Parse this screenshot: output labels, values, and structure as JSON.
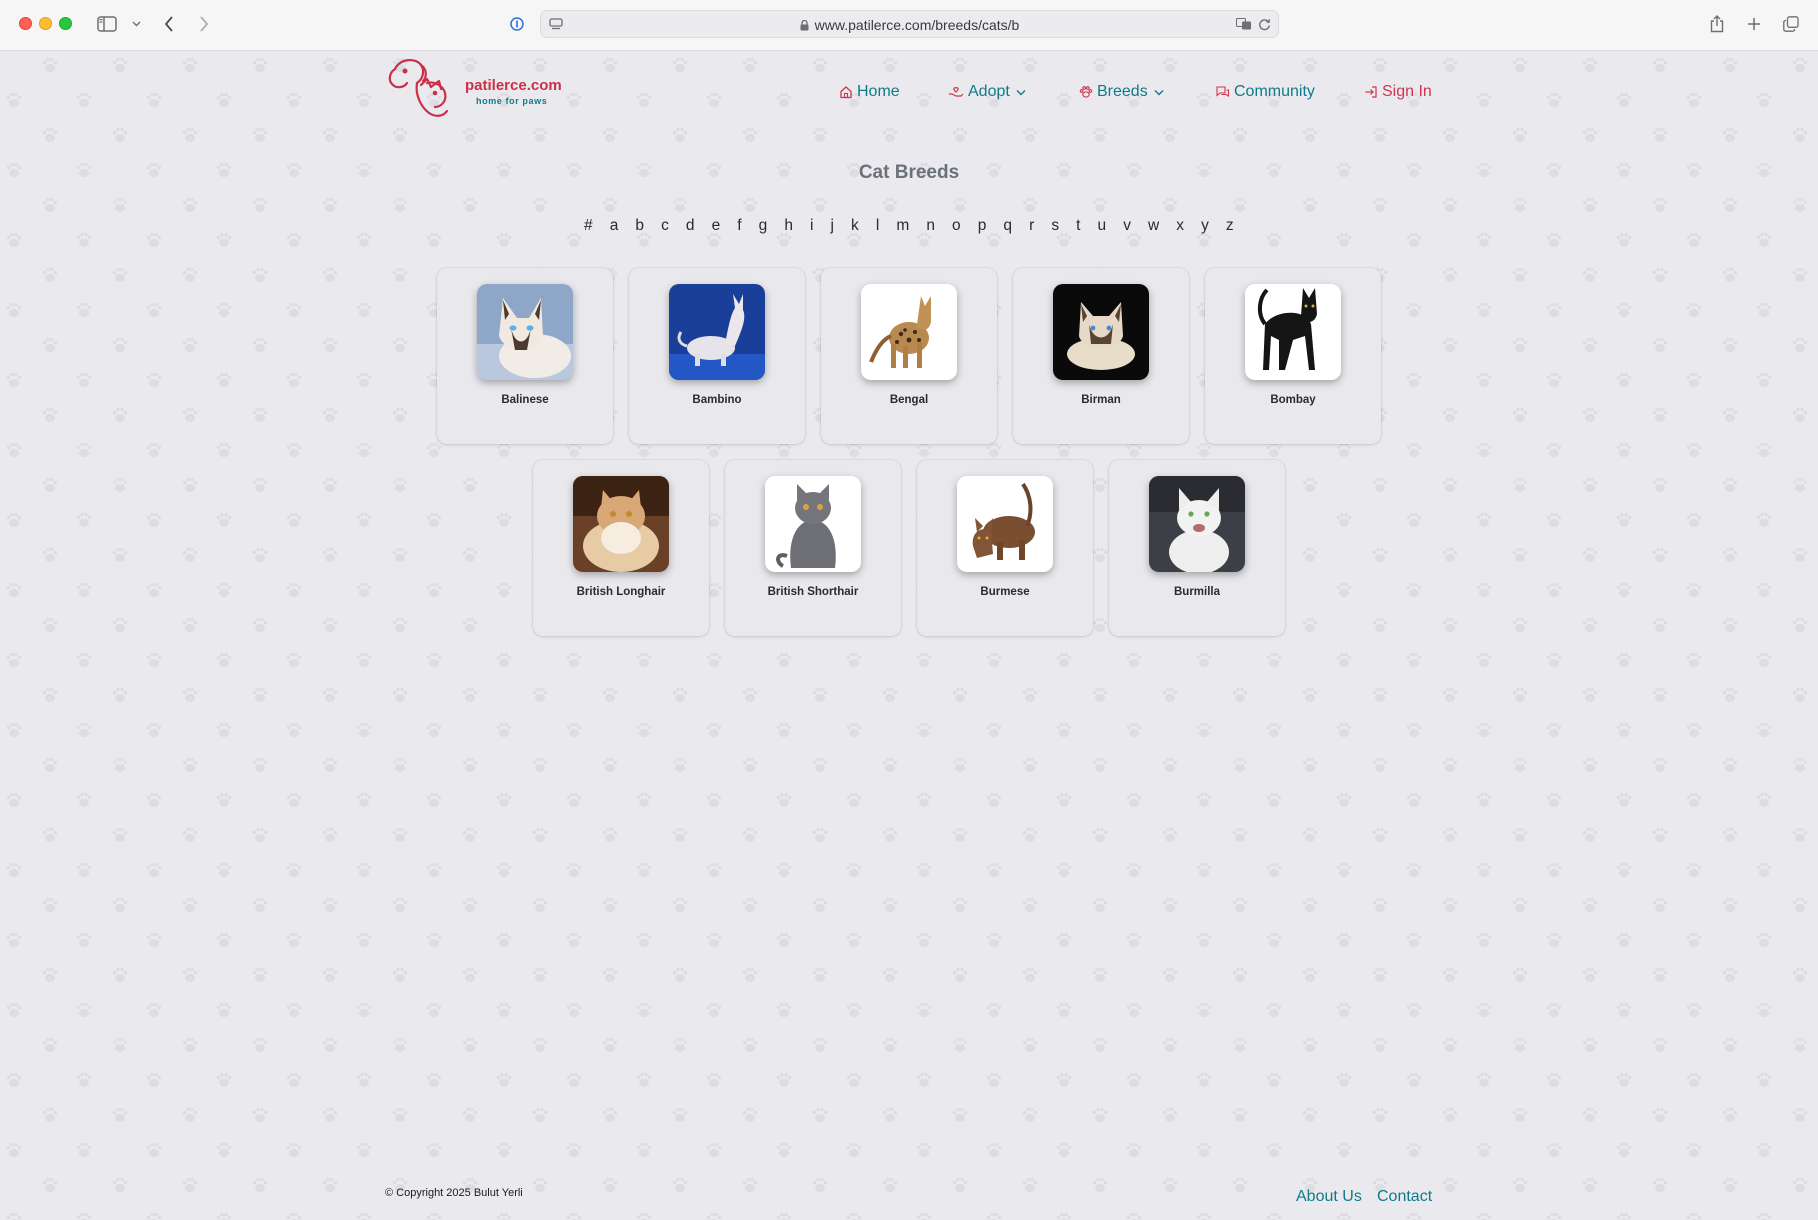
{
  "browser": {
    "url": "www.patilerce.com/breeds/cats/b"
  },
  "site": {
    "logo_name": "patilerce.com",
    "logo_tagline": "home for paws",
    "brand_color": "#c9304a",
    "accent_color": "#0f7a8a"
  },
  "nav": {
    "home": "Home",
    "adopt": "Adopt",
    "breeds": "Breeds",
    "community": "Community",
    "signin": "Sign In"
  },
  "main": {
    "title": "Cat Breeds",
    "letters": [
      "#",
      "a",
      "b",
      "c",
      "d",
      "e",
      "f",
      "g",
      "h",
      "i",
      "j",
      "k",
      "l",
      "m",
      "n",
      "o",
      "p",
      "q",
      "r",
      "s",
      "t",
      "u",
      "v",
      "w",
      "x",
      "y",
      "z"
    ],
    "breeds": [
      {
        "name": "Balinese"
      },
      {
        "name": "Bambino"
      },
      {
        "name": "Bengal"
      },
      {
        "name": "Birman"
      },
      {
        "name": "Bombay"
      },
      {
        "name": "British Longhair"
      },
      {
        "name": "British Shorthair"
      },
      {
        "name": "Burmese"
      },
      {
        "name": "Burmilla"
      }
    ]
  },
  "footer": {
    "copyright": "© Copyright 2025 Bulut Yerli",
    "about": "About Us",
    "contact": "Contact"
  }
}
